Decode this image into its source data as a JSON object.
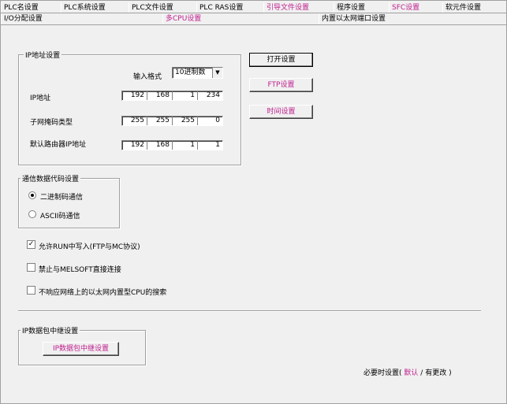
{
  "tabs_row1": [
    "PLC名设置",
    "PLC系统设置",
    "PLC文件设置",
    "PLC RAS设置",
    "引导文件设置",
    "程序设置",
    "SFC设置",
    "软元件设置"
  ],
  "tabs_row2": [
    "I/O分配设置",
    "多CPU设置",
    "内置以太网端口设置"
  ],
  "ip_group": {
    "title": "IP地址设置",
    "format_label": "输入格式",
    "format_value": "10进制数",
    "ip_label": "IP地址",
    "ip": [
      "192",
      "168",
      "1",
      "234"
    ],
    "mask_label": "子网掩码类型",
    "mask": [
      "255",
      "255",
      "255",
      "0"
    ],
    "gateway_label": "默认路由器IP地址",
    "gateway": [
      "192",
      "168",
      "1",
      "1"
    ]
  },
  "buttons": {
    "open": "打开设置",
    "ftp": "FTP设置",
    "time": "时间设置",
    "relay": "IP数据包中继设置"
  },
  "comm_group": {
    "title": "通信数据代码设置",
    "binary": "二进制码通信",
    "ascii": "ASCII码通信"
  },
  "checks": {
    "allow_run_write": "允许RUN中写入(FTP与MC协议)",
    "forbid_melsoft": "禁止与MELSOFT直接连接",
    "no_search": "不响应网络上的以太网内置型CPU的搜索"
  },
  "relay_group": {
    "title": "IP数据包中继设置"
  },
  "footer": {
    "prefix": "必要时设置(",
    "default": "默认",
    "sep": "/",
    "changed": "有更改",
    "suffix": ")"
  },
  "colors": {
    "accent": "#c0208f",
    "bg": "#f0f0f0"
  }
}
